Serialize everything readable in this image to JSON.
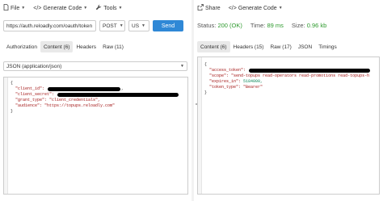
{
  "request": {
    "menu": {
      "file_label": "File",
      "generate_code_label": "Generate Code",
      "tools_label": "Tools"
    },
    "url": "https://auth.reloadly.com/oauth/token",
    "method": "POST",
    "region": "US",
    "send_label": "Send",
    "tabs": [
      {
        "label": "Authorization"
      },
      {
        "label": "Content (6)"
      },
      {
        "label": "Headers"
      },
      {
        "label": "Raw (11)"
      }
    ],
    "content_type": "JSON (application/json)",
    "body": {
      "open": "{",
      "k_client_id": "\"client_id\":",
      "k_client_secret": "\"client_secret\":",
      "k_grant_type": "\"grant_type\":",
      "v_grant_type": "\"client_credentials\",",
      "k_audience": "\"audience\":",
      "v_audience": "\"https://topups.reloadly.com\"",
      "comma": ",",
      "close": "}"
    }
  },
  "response": {
    "menu": {
      "share_label": "Share",
      "generate_code_label": "Generate Code"
    },
    "status": {
      "label": "Status:",
      "value": "200 (OK)"
    },
    "time": {
      "label": "Time:",
      "value": "89 ms"
    },
    "size": {
      "label": "Size:",
      "value": "0.96 kb"
    },
    "tabs": [
      {
        "label": "Content (6)"
      },
      {
        "label": "Headers (15)"
      },
      {
        "label": "Raw (17)"
      },
      {
        "label": "JSON"
      },
      {
        "label": "Timings"
      }
    ],
    "body": {
      "open": "{",
      "k_access_token": "\"access_token\":",
      "k_scope": "\"scope\":",
      "v_scope": "\"send-topups read-operators read-promotions read-topups-h",
      "k_expires_in": "\"expires_in\":",
      "v_expires_in": "5184000,",
      "k_token_type": "\"token_type\":",
      "v_token_type": "\"Bearer\"",
      "close": "}"
    }
  },
  "colors": {
    "send_button": "#2f88d6",
    "status_ok": "#2e9a2e",
    "json_key": "#a31515",
    "json_number": "#098658",
    "active_tab": "#e9e9e9"
  },
  "icons": [
    "file-icon",
    "code-icon",
    "tools-icon",
    "share-icon"
  ]
}
